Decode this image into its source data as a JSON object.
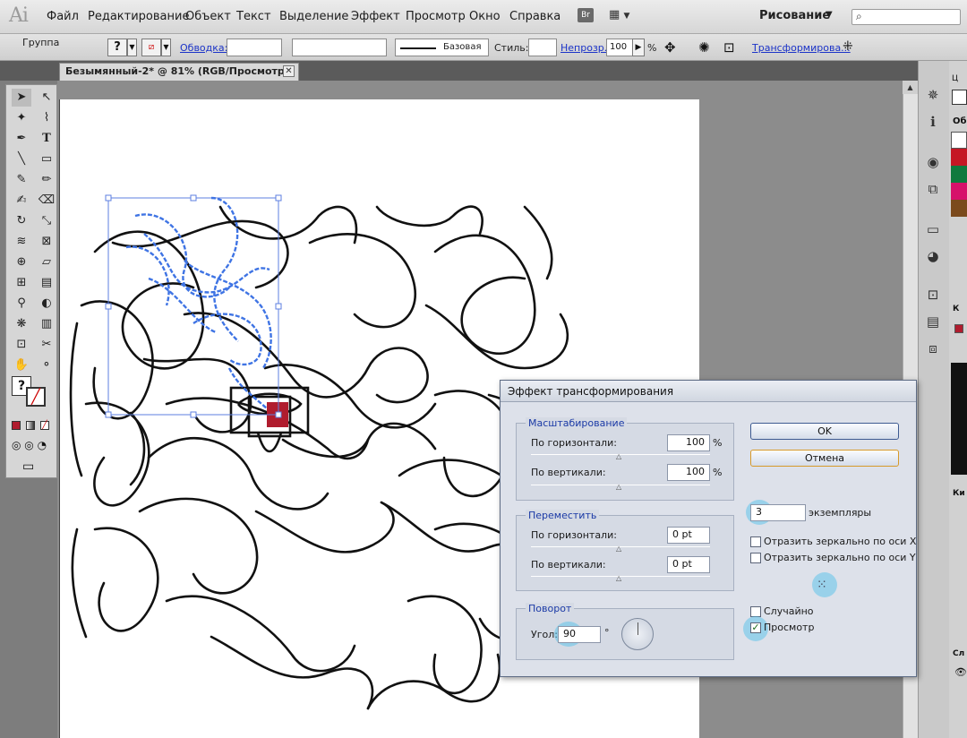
{
  "app": {
    "logo": "Ai",
    "workspace": "Рисование"
  },
  "menu": [
    "Файл",
    "Редактирование",
    "Объект",
    "Текст",
    "Выделение",
    "Эффект",
    "Просмотр",
    "Окно",
    "Справка"
  ],
  "topbar": {
    "bridge_label": "Br"
  },
  "control_bar": {
    "selection_label": "Группа",
    "stroke_link": "Обводка:",
    "stroke_profile": "Базовая",
    "style_label": "Стиль:",
    "opacity_link": "Непрозр.:",
    "opacity_value": "100",
    "opacity_unit": "%",
    "transform_link": "Трансформирова..."
  },
  "document": {
    "tab_title": "Безымянный-2* @ 81% (RGB/Просмотр)",
    "close_glyph": "✕"
  },
  "dialog": {
    "title": "Эффект трансформирования",
    "scale": {
      "label": "Масштабирование",
      "horizontal_label": "По горизонтали:",
      "horizontal_value": "100",
      "vertical_label": "По вертикали:",
      "vertical_value": "100",
      "unit": "%"
    },
    "move": {
      "label": "Переместить",
      "horizontal_label": "По горизонтали:",
      "horizontal_value": "0 pt",
      "vertical_label": "По вертикали:",
      "vertical_value": "0 pt"
    },
    "rotate": {
      "label": "Поворот",
      "angle_label": "Угол:",
      "angle_value": "90",
      "angle_unit": "°"
    },
    "ok_label": "OK",
    "cancel_label": "Отмена",
    "copies_value": "3",
    "copies_label": "экземпляры",
    "reflect_x_label": "Отразить зеркально по оси X",
    "reflect_y_label": "Отразить зеркально по оси Y",
    "random_label": "Случайно",
    "preview_label": "Просмотр",
    "preview_checked": true
  },
  "colors": {
    "accent_blue": "#3f74e4",
    "selection_red": "#b01c2e",
    "dialog_bg": "#dde1ea"
  },
  "panel_labels": {
    "p1": "Ц",
    "p2": "Об",
    "p3": "К",
    "p4": "Ки",
    "p5": "Сл"
  }
}
